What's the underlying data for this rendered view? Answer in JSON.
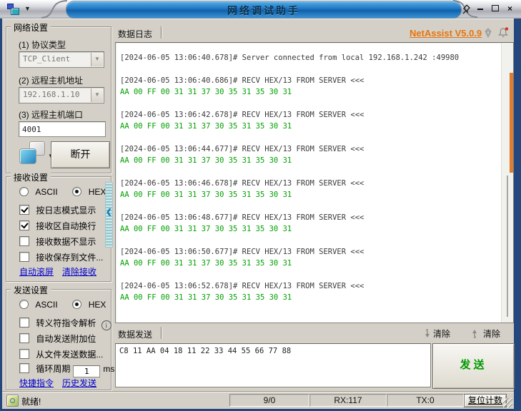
{
  "window": {
    "title": "网络调试助手",
    "close_glyph": "×"
  },
  "network_settings": {
    "title": "网络设置",
    "protocol_label": "(1) 协议类型",
    "protocol_value": "TCP_Client",
    "host_label": "(2) 远程主机地址",
    "host_value": "192.168.1.10",
    "port_label": "(3) 远程主机端口",
    "port_value": "4001",
    "disconnect_label": "断开"
  },
  "receive_settings": {
    "title": "接收设置",
    "ascii_label": "ASCII",
    "hex_label": "HEX",
    "ascii_selected": false,
    "hex_selected": true,
    "options": [
      {
        "label": "按日志模式显示",
        "checked": true
      },
      {
        "label": "接收区自动换行",
        "checked": true
      },
      {
        "label": "接收数据不显示",
        "checked": false
      },
      {
        "label": "接收保存到文件...",
        "checked": false
      }
    ],
    "links": {
      "auto_scroll": "自动滚屏",
      "clear_receive": "清除接收"
    }
  },
  "send_settings": {
    "title": "发送设置",
    "ascii_label": "ASCII",
    "hex_label": "HEX",
    "ascii_selected": false,
    "hex_selected": true,
    "options": [
      {
        "label": "转义符指令解析",
        "checked": false
      },
      {
        "label": "自动发送附加位",
        "checked": false
      },
      {
        "label": "从文件发送数据...",
        "checked": false
      },
      {
        "label": "循环周期",
        "checked": false
      }
    ],
    "cycle_value": "1",
    "cycle_unit": "ms",
    "links": {
      "quick_commands": "快捷指令",
      "send_history": "历史发送"
    }
  },
  "log": {
    "tab": "数据日志",
    "version": "NetAssist V5.0.9",
    "entries": [
      {
        "header": "[2024-06-05 13:06:40.678]# Server connected from local 192.168.1.242 :49980",
        "hex": ""
      },
      {
        "header": "[2024-06-05 13:06:40.686]# RECV HEX/13 FROM SERVER <<<",
        "hex": "AA 00 FF 00 31 31 37 30 35 31 35 30 31"
      },
      {
        "header": "[2024-06-05 13:06:42.678]# RECV HEX/13 FROM SERVER <<<",
        "hex": "AA 00 FF 00 31 31 37 30 35 31 35 30 31"
      },
      {
        "header": "[2024-06-05 13:06:44.677]# RECV HEX/13 FROM SERVER <<<",
        "hex": "AA 00 FF 00 31 31 37 30 35 31 35 30 31"
      },
      {
        "header": "[2024-06-05 13:06:46.678]# RECV HEX/13 FROM SERVER <<<",
        "hex": "AA 00 FF 00 31 31 37 30 35 31 35 30 31"
      },
      {
        "header": "[2024-06-05 13:06:48.677]# RECV HEX/13 FROM SERVER <<<",
        "hex": "AA 00 FF 00 31 31 37 30 35 31 35 30 31"
      },
      {
        "header": "[2024-06-05 13:06:50.677]# RECV HEX/13 FROM SERVER <<<",
        "hex": "AA 00 FF 00 31 31 37 30 35 31 35 30 31"
      },
      {
        "header": "[2024-06-05 13:06:52.678]# RECV HEX/13 FROM SERVER <<<",
        "hex": "AA 00 FF 00 31 31 37 30 35 31 35 30 31"
      }
    ]
  },
  "send": {
    "tab": "数据发送",
    "clear_down_label": "清除",
    "clear_up_label": "清除",
    "data": "C8 11 AA 04 18 11 22 33 44 55 66 77 88",
    "send_label": "发送"
  },
  "status": {
    "ready": "就绪!",
    "counter": "9/0",
    "rx": "RX:117",
    "tx": "TX:0",
    "reset_label": "复位计数"
  },
  "colors": {
    "hex_green": "#00a000",
    "version_orange": "#e8740c",
    "scroll_thumb_orange": "#e07c30",
    "link_blue": "#0000cc",
    "titlebar_blue": "#1f76c0"
  }
}
